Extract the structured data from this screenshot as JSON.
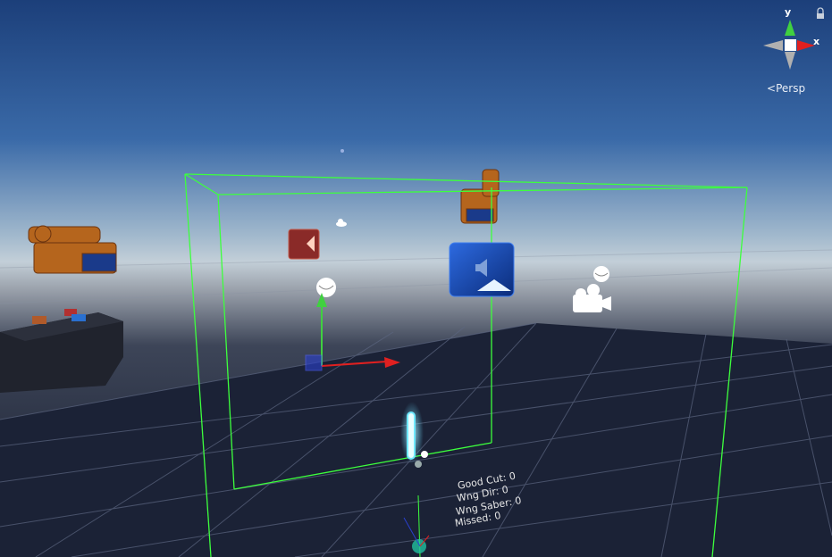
{
  "scene_view": {
    "projection_label": "Persp",
    "axis_labels": {
      "x": "x",
      "y": "y"
    },
    "stats": {
      "good_cut": "Good Cut: 0",
      "wrong_dir": "Wng Dir: 0",
      "wrong_saber": "Wng Saber: 0",
      "missed": "Missed: 0"
    }
  },
  "colors": {
    "sky_top": "#1c3f7a",
    "sky_horizon": "#b8c8d6",
    "ground": "#1b2236",
    "bounds_box": "#3dff3d",
    "blue_note": "#1144bb",
    "red_note": "#8a2a28",
    "saber_glow": "#6fe9ff",
    "axis_x": "#e02020",
    "axis_y": "#40d040",
    "axis_z": "#2a40d0"
  },
  "icons": [
    "lock-icon",
    "camera-gizmo-icon",
    "light-gizmo-icon",
    "audio-source-icon",
    "note-arrow-icon"
  ]
}
